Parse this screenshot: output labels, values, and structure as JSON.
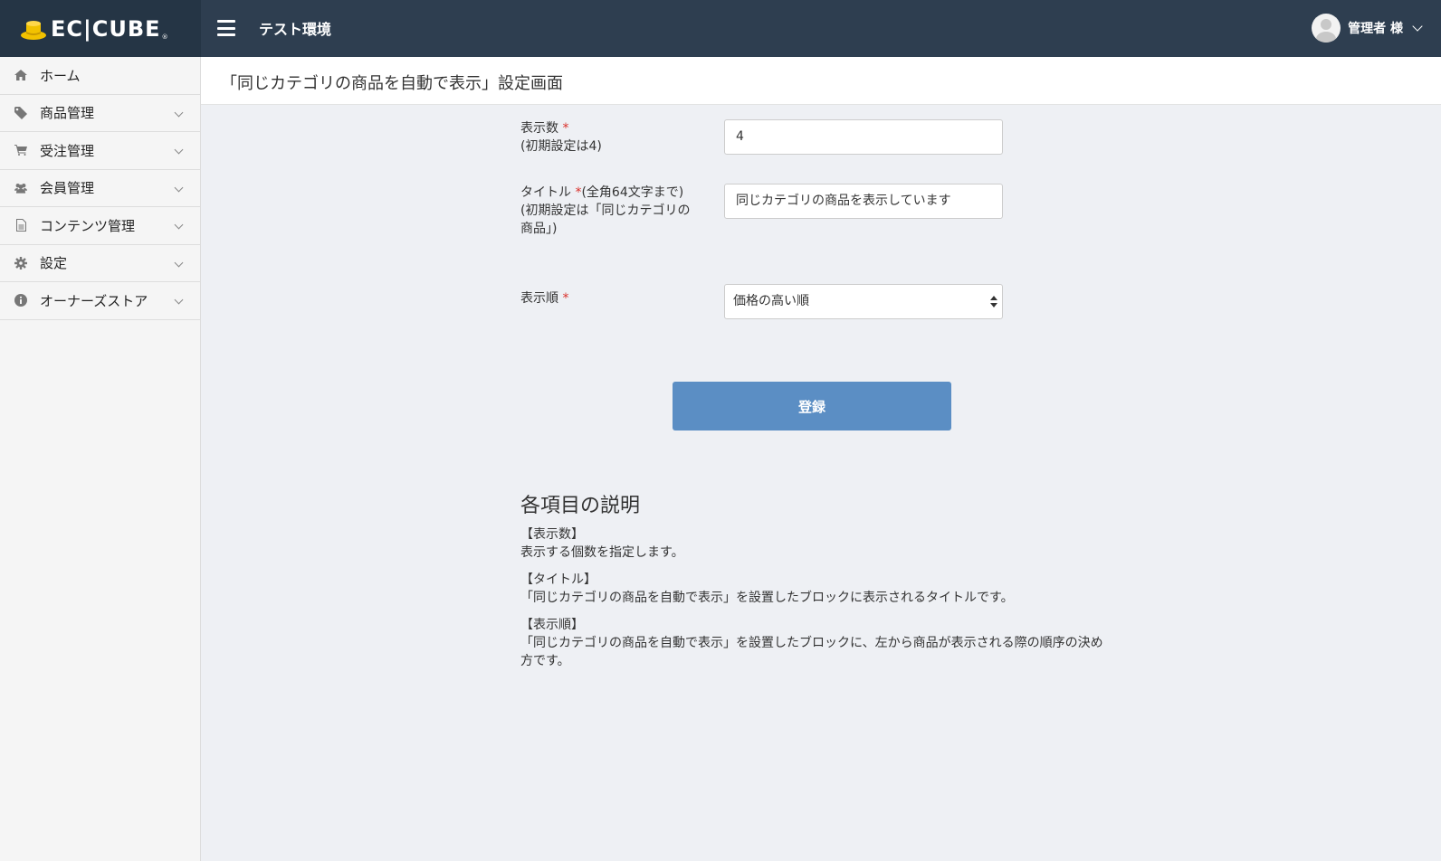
{
  "header": {
    "logo_text": "EC|CUBE",
    "logo_reg": "®",
    "env_title": "テスト環境",
    "user_name": "管理者 様"
  },
  "sidebar": {
    "items": [
      {
        "label": "ホーム",
        "icon": "home-icon"
      },
      {
        "label": "商品管理",
        "icon": "tag-icon"
      },
      {
        "label": "受注管理",
        "icon": "cart-icon"
      },
      {
        "label": "会員管理",
        "icon": "users-icon"
      },
      {
        "label": "コンテンツ管理",
        "icon": "document-icon"
      },
      {
        "label": "設定",
        "icon": "gear-icon"
      },
      {
        "label": "オーナーズストア",
        "icon": "info-icon"
      }
    ]
  },
  "page": {
    "title": "「同じカテゴリの商品を自動で表示」設定画面"
  },
  "form": {
    "count": {
      "label": "表示数",
      "required": "*",
      "note": "(初期設定は4)",
      "value": "4"
    },
    "title": {
      "label": "タイトル",
      "required": "*",
      "label_suffix": "(全角64文字まで)",
      "note": "(初期設定は「同じカテゴリの商品」)",
      "value": "同じカテゴリの商品を表示しています"
    },
    "order": {
      "label": "表示順",
      "required": "*",
      "value": "価格の高い順"
    },
    "submit_label": "登録"
  },
  "description": {
    "heading": "各項目の説明",
    "blocks": [
      {
        "title": "【表示数】",
        "text": "表示する個数を指定します。"
      },
      {
        "title": "【タイトル】",
        "text": "「同じカテゴリの商品を自動で表示」を設置したブロックに表示されるタイトルです。"
      },
      {
        "title": "【表示順】",
        "text": "「同じカテゴリの商品を自動で表示」を設置したブロックに、左から商品が表示される際の順序の決め方です。"
      }
    ]
  },
  "colors": {
    "header_bg": "#2e3e50",
    "logo_bg": "#253545",
    "accent_button": "#5b8ec4",
    "required_mark": "#d9302b",
    "logo_mark": "#f2c200"
  }
}
